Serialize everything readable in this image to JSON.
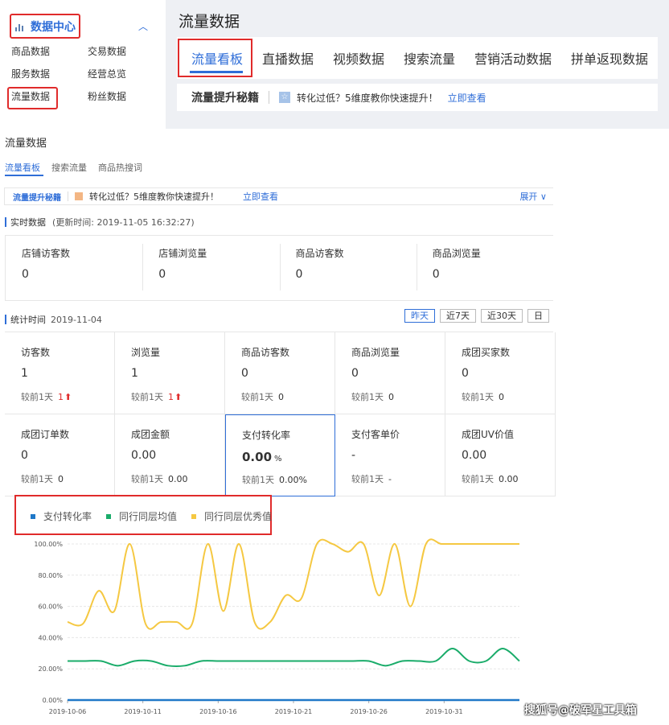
{
  "sidebar": {
    "section_title": "数据中心",
    "items": [
      "商品数据",
      "交易数据",
      "服务数据",
      "经营总览",
      "流量数据",
      "粉丝数据"
    ]
  },
  "header": {
    "title": "流量数据",
    "tabs": [
      "流量看板",
      "直播数据",
      "视频数据",
      "搜索流量",
      "营销活动数据",
      "拼单返现数据"
    ],
    "tip_title": "流量提升秘籍",
    "tip_text": "转化过低？5维度教你快速提升！",
    "tip_link": "立即查看"
  },
  "main": {
    "title": "流量数据",
    "tabs": [
      "流量看板",
      "搜索流量",
      "商品热搜词"
    ],
    "tip_title": "流量提升秘籍",
    "tip_text": "转化过低？5维度教你快速提升！",
    "tip_link": "立即查看",
    "tip_expand": "展开 ∨",
    "realtime": {
      "title": "实时数据",
      "updated": "(更新时间: 2019-11-05 16:32:27)",
      "metrics": [
        {
          "label": "店铺访客数",
          "value": "0"
        },
        {
          "label": "店铺浏览量",
          "value": "0"
        },
        {
          "label": "商品访客数",
          "value": "0"
        },
        {
          "label": "商品浏览量",
          "value": "0"
        }
      ]
    },
    "stats": {
      "title": "统计时间",
      "date": "2019-11-04",
      "ranges": [
        "昨天",
        "近7天",
        "近30天",
        "日"
      ],
      "cells": [
        {
          "label": "访客数",
          "value": "1",
          "cmp": "较前1天",
          "cmp_val": "1",
          "up": true
        },
        {
          "label": "浏览量",
          "value": "1",
          "cmp": "较前1天",
          "cmp_val": "1",
          "up": true
        },
        {
          "label": "商品访客数",
          "value": "0",
          "cmp": "较前1天",
          "cmp_val": "0",
          "up": false
        },
        {
          "label": "商品浏览量",
          "value": "0",
          "cmp": "较前1天",
          "cmp_val": "0",
          "up": false
        },
        {
          "label": "成团买家数",
          "value": "0",
          "cmp": "较前1天",
          "cmp_val": "0",
          "up": false
        },
        {
          "label": "成团订单数",
          "value": "0",
          "cmp": "较前1天",
          "cmp_val": "0",
          "up": false
        },
        {
          "label": "成团金额",
          "value": "0.00",
          "cmp": "较前1天",
          "cmp_val": "0.00",
          "up": false
        },
        {
          "label": "支付转化率",
          "value": "0.00",
          "unit": "%",
          "cmp": "较前1天",
          "cmp_val": "0.00%",
          "up": false
        },
        {
          "label": "支付客单价",
          "value": "-",
          "cmp": "较前1天",
          "cmp_val": "-",
          "up": false
        },
        {
          "label": "成团UV价值",
          "value": "0.00",
          "cmp": "较前1天",
          "cmp_val": "0.00",
          "up": false
        }
      ]
    }
  },
  "colors": {
    "accent": "#2f6ed8",
    "highlight": "#e02b2b",
    "series_blue": "#1f78c8",
    "series_green": "#1aac6a",
    "series_yellow": "#f5c842"
  },
  "chart_data": {
    "type": "line",
    "legend": [
      "支付转化率",
      "同行同层均值",
      "同行同层优秀值"
    ],
    "ylim": [
      0,
      100
    ],
    "yticks": [
      "0.00%",
      "20.00%",
      "40.00%",
      "60.00%",
      "80.00%",
      "100.00%"
    ],
    "xticks": [
      "2019-10-06",
      "2019-10-11",
      "2019-10-16",
      "2019-10-21",
      "2019-10-26",
      "2019-10-31"
    ],
    "series": [
      {
        "name": "支付转化率",
        "color": "#1f78c8",
        "values": [
          0,
          0,
          0,
          0,
          0,
          0,
          0,
          0,
          0,
          0,
          0,
          0,
          0,
          0,
          0,
          0,
          0,
          0,
          0,
          0,
          0,
          0,
          0,
          0,
          0,
          0,
          0,
          0,
          0,
          0,
          0
        ]
      },
      {
        "name": "同行同层均值",
        "color": "#1aac6a",
        "values": [
          25,
          25,
          25,
          22,
          25,
          25,
          22,
          22,
          25,
          25,
          25,
          25,
          25,
          25,
          25,
          25,
          25,
          25,
          25,
          22,
          25,
          25,
          25,
          33,
          25,
          25,
          33,
          25
        ]
      },
      {
        "name": "同行同层优秀值",
        "color": "#f5c842",
        "values": [
          50,
          49,
          70,
          57,
          100,
          49,
          50,
          50,
          49,
          100,
          57,
          100,
          50,
          50,
          67,
          65,
          100,
          100,
          95,
          100,
          67,
          100,
          60,
          100,
          100,
          100,
          100,
          100,
          100,
          100
        ]
      }
    ]
  },
  "watermark": "搜狐号@破军星工具箱"
}
